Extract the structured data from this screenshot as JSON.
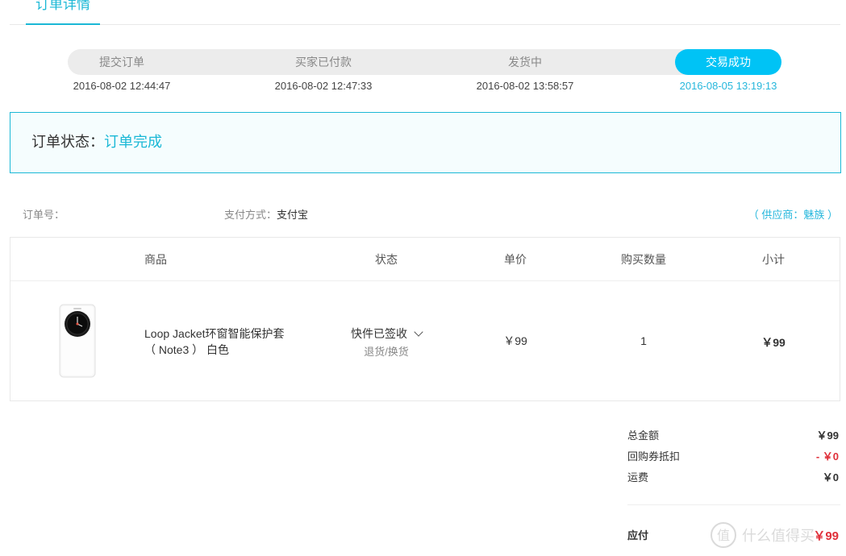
{
  "header": {
    "tab_label": "订单详情"
  },
  "progress": {
    "steps": [
      {
        "label": "提交订单",
        "time": "2016-08-02 12:44:47"
      },
      {
        "label": "买家已付款",
        "time": "2016-08-02 12:47:33"
      },
      {
        "label": "发货中",
        "time": "2016-08-02 13:58:57"
      },
      {
        "label": "交易成功",
        "time": "2016-08-05 13:19:13"
      }
    ],
    "active_color": "#00c3f5"
  },
  "status": {
    "label": "订单状态：",
    "value": "订单完成"
  },
  "info": {
    "order_no_label": "订单号：",
    "payment_label": "支付方式：",
    "payment_value": "支付宝",
    "supplier": "（ 供应商：魅族 ）"
  },
  "table": {
    "headers": [
      "商品",
      "状态",
      "单价",
      "购买数量",
      "小计"
    ],
    "rows": [
      {
        "name_line1": "Loop Jacket环窗智能保护套",
        "name_line2": "（ Note3 ） 白色",
        "status": "快件已签收",
        "status_link": "退货/换货",
        "price": "￥99",
        "qty": "1",
        "subtotal": "￥99"
      }
    ]
  },
  "totals": {
    "total_label": "总金额",
    "total_value": "￥99",
    "coupon_label": "回购券抵扣",
    "coupon_value": "- ￥0",
    "shipping_label": "运费",
    "shipping_value": "￥0",
    "payable_label": "应付",
    "payable_value": "￥99"
  },
  "watermark": {
    "text": "什么值得买",
    "icon": "zhi-logo-icon"
  }
}
